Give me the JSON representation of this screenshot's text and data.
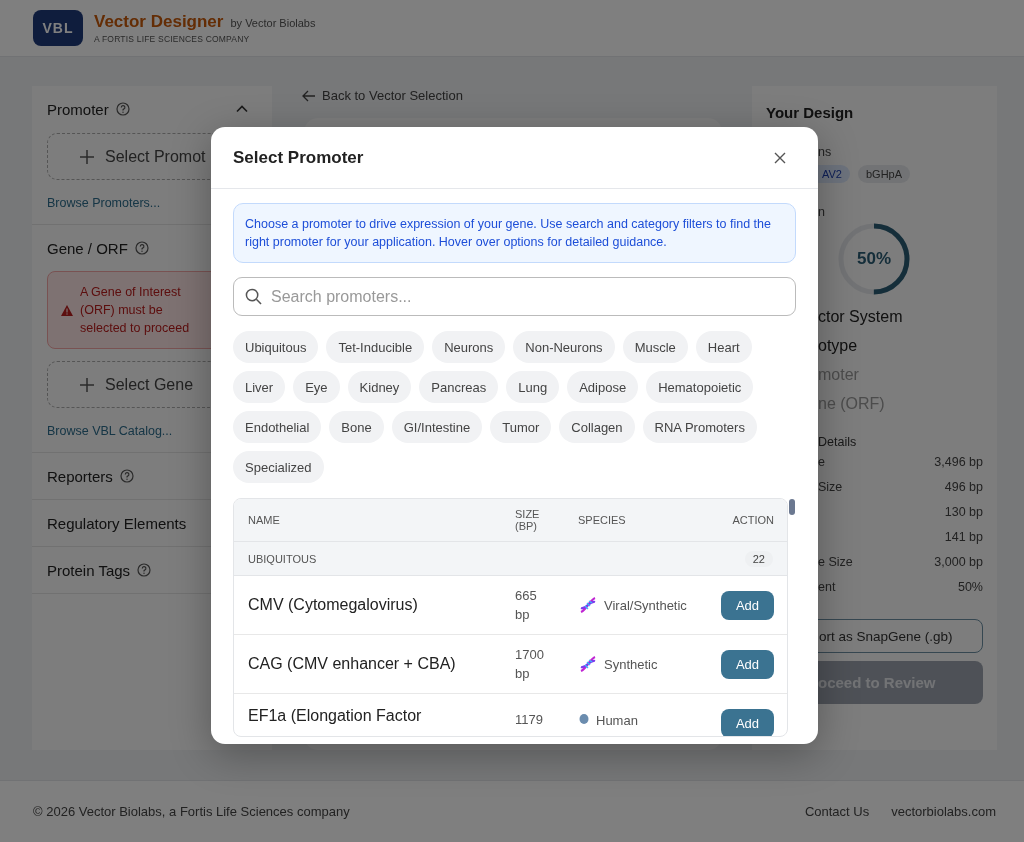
{
  "header": {
    "logo": "VBL",
    "title": "Vector Designer",
    "byline": "by Vector Biolabs",
    "tagline": "A FORTIS LIFE SCIENCES COMPANY"
  },
  "sidebar": {
    "sections": [
      {
        "title": "Promoter",
        "help": true,
        "expanded": true,
        "select_button": "Select Promot",
        "link": "Browse Promoters..."
      },
      {
        "title": "Gene / ORF",
        "help": true,
        "alert": "A Gene of Interest (ORF) must be selected to proceed",
        "select_button": "Select Gene",
        "link": "Browse VBL Catalog..."
      },
      {
        "title": "Reporters",
        "help": true
      },
      {
        "title": "Regulatory Elements"
      },
      {
        "title": "Protein Tags",
        "help": true
      }
    ]
  },
  "back_link": "Back to Vector Selection",
  "design": {
    "title": "Your Design",
    "components_label": "ns",
    "chips": [
      {
        "label": "AV2",
        "kind": "serotype"
      },
      {
        "label": "bGHpA",
        "kind": "element"
      }
    ],
    "progress_label": "n",
    "progress": {
      "level": 0.5,
      "reading": "50%"
    },
    "checklist": [
      {
        "label": "ctor System",
        "done": true
      },
      {
        "label": "otype",
        "done": true
      },
      {
        "label": "moter",
        "done": false
      },
      {
        "label": "ne (ORF)",
        "done": false
      }
    ],
    "details_label": "Details",
    "details": [
      {
        "label": "e",
        "value": "3,496 bp"
      },
      {
        "label": "Size",
        "value": "496 bp"
      },
      {
        "value": "130 bp"
      },
      {
        "value": "141 bp"
      },
      {
        "label": "e Size",
        "value": "3,000 bp"
      },
      {
        "label": "ent",
        "value": "50%"
      }
    ],
    "export_button": "ort as SnapGene (.gb)",
    "proceed_button": {
      "label": "oceed to Review",
      "disabled": true
    }
  },
  "modal": {
    "title": "Select Promoter",
    "info": "Choose a promoter to drive expression of your gene. Use search and category filters to find the right promoter for your application. Hover over options for detailed guidance.",
    "search": {
      "placeholder": "Search promoters..."
    },
    "filters": [
      {
        "label": "Ubiquitous",
        "selected": false
      },
      {
        "label": "Tet-Inducible",
        "selected": false
      },
      {
        "label": "Neurons",
        "selected": false
      },
      {
        "label": "Non-Neurons",
        "selected": false
      },
      {
        "label": "Muscle",
        "selected": false
      },
      {
        "label": "Heart",
        "selected": false
      },
      {
        "label": "Liver",
        "selected": false
      },
      {
        "label": "Eye",
        "selected": false
      },
      {
        "label": "Kidney",
        "selected": false
      },
      {
        "label": "Pancreas",
        "selected": false
      },
      {
        "label": "Lung",
        "selected": false
      },
      {
        "label": "Adipose",
        "selected": false
      },
      {
        "label": "Hematopoietic",
        "selected": false
      },
      {
        "label": "Endothelial",
        "selected": false
      },
      {
        "label": "Bone",
        "selected": false
      },
      {
        "label": "GI/Intestine",
        "selected": false
      },
      {
        "label": "Tumor",
        "selected": false
      },
      {
        "label": "Collagen",
        "selected": false
      },
      {
        "label": "RNA Promoters",
        "selected": false
      },
      {
        "label": "Specialized",
        "selected": false
      }
    ],
    "columns": [
      "NAME",
      "SIZE (BP)",
      "SPECIES",
      "ACTION"
    ],
    "groups": [
      {
        "name": "UBIQUITOUS",
        "count": "22",
        "rows": [
          {
            "name": "CMV (Cytomegalovirus)",
            "size": "665 bp",
            "species": "Viral/Synthetic",
            "kind": "synthetic",
            "action": "Add"
          },
          {
            "name": "CAG (CMV enhancer + CBA)",
            "size": "1700 bp",
            "species": "Synthetic",
            "kind": "synthetic",
            "action": "Add"
          },
          {
            "name": "EF1a (Elongation Factor",
            "size": "1179",
            "species": "Human",
            "kind": "human",
            "action": "Add"
          }
        ]
      }
    ]
  },
  "footer": {
    "copyright": "© 2026 Vector Biolabs, a Fortis Life Sciences company",
    "links": [
      "Contact Us",
      "vectorbiolabs.com"
    ]
  }
}
